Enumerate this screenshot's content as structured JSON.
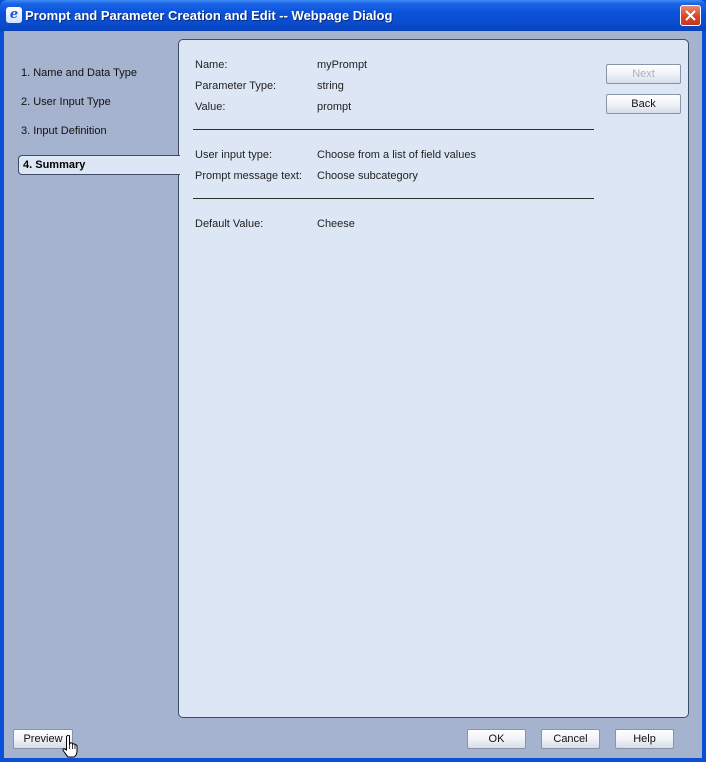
{
  "window": {
    "title": "Prompt and Parameter Creation and Edit -- Webpage Dialog"
  },
  "nav": {
    "items": [
      "1. Name and Data Type",
      "2. User Input Type",
      "3. Input Definition"
    ],
    "active": "4. Summary"
  },
  "summary": {
    "name_label": "Name:",
    "name_value": "myPrompt",
    "param_type_label": "Parameter Type:",
    "param_type_value": "string",
    "value_label": "Value:",
    "value_value": "prompt",
    "input_type_label": "User input type:",
    "input_type_value": "Choose from a list of field values",
    "prompt_msg_label": "Prompt message text:",
    "prompt_msg_value": "Choose subcategory",
    "default_label": "Default Value:",
    "default_value": "Cheese"
  },
  "buttons": {
    "next": "Next",
    "back": "Back",
    "preview": "Preview",
    "ok": "OK",
    "cancel": "Cancel",
    "help": "Help"
  }
}
